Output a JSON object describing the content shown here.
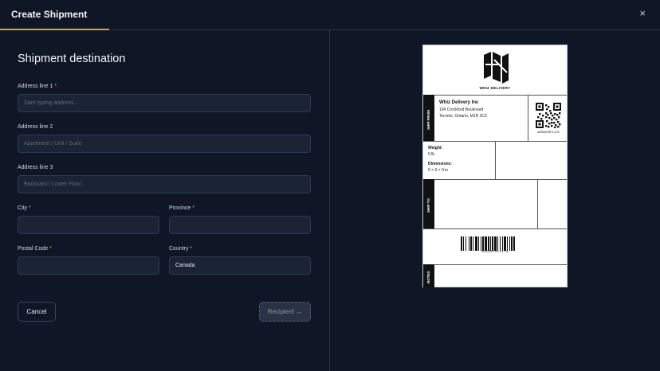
{
  "header": {
    "title": "Create Shipment",
    "close_icon": "×"
  },
  "progress": {
    "fraction": 0.165,
    "color": "#e0a03a"
  },
  "form": {
    "section_title": "Shipment destination",
    "address1": {
      "label": "Address line 1",
      "required": "*",
      "placeholder": "Start typing address...",
      "value": ""
    },
    "address2": {
      "label": "Address line 2",
      "placeholder": "Apartment / Unit / Suite",
      "value": ""
    },
    "address3": {
      "label": "Address line 3",
      "placeholder": "Backyard / Lower Floor",
      "value": ""
    },
    "city": {
      "label": "City",
      "required": "*",
      "value": ""
    },
    "province": {
      "label": "Province",
      "required": "*",
      "value": ""
    },
    "postal": {
      "label": "Postal Code",
      "required": "*",
      "value": ""
    },
    "country": {
      "label": "Country",
      "required": "*",
      "value": "Canada"
    },
    "cancel_label": "Cancel",
    "next_label": "Recipient →"
  },
  "label_preview": {
    "brand": "WHIZ DELIVERY",
    "ship_from_tag": "SHIP FROM",
    "ship_from": {
      "name": "Whiz Delivery Inc",
      "line1": "104 Crockford Boulevard",
      "line2": "Toronto, Ontario, M1R 3C3"
    },
    "qr_id": "WZ56A78F1179",
    "weight_label": "Weight:",
    "weight_value": "0 lb",
    "dimensions_label": "Dimensions:",
    "dimensions_value": "0 × 0 × 0 in",
    "ship_to_tag": "SHIP TO",
    "barcode_id": "RE56A78F1179",
    "notes_tag": "NOTES"
  }
}
